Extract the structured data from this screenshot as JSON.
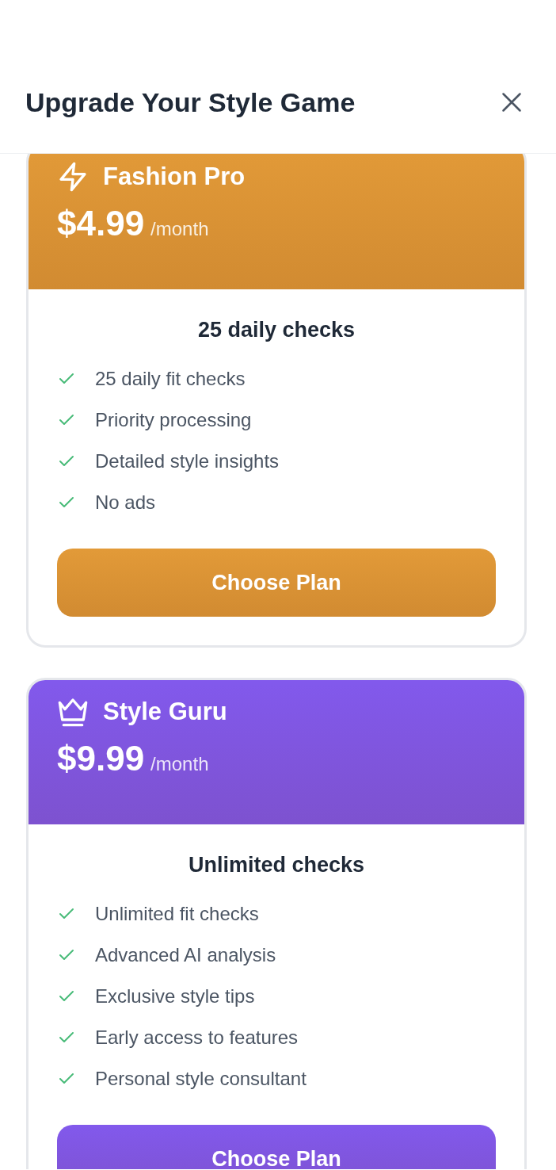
{
  "header": {
    "title": "Upgrade Your Style Game"
  },
  "plans": [
    {
      "kind": "bolt",
      "name": "Fashion Pro",
      "price": "$4.99",
      "period": "/month",
      "color": "#e29a38",
      "subtitle": "25 daily checks",
      "features": [
        "25 daily fit checks",
        "Priority processing",
        "Detailed style insights",
        "No ads"
      ],
      "button": "Choose Plan"
    },
    {
      "kind": "crown",
      "name": "Style Guru",
      "price": "$9.99",
      "period": "/month",
      "color": "#8259ec",
      "subtitle": "Unlimited checks",
      "features": [
        "Unlimited fit checks",
        "Advanced AI analysis",
        "Exclusive style tips",
        "Early access to features",
        "Personal style consultant"
      ],
      "button": "Choose Plan"
    }
  ]
}
